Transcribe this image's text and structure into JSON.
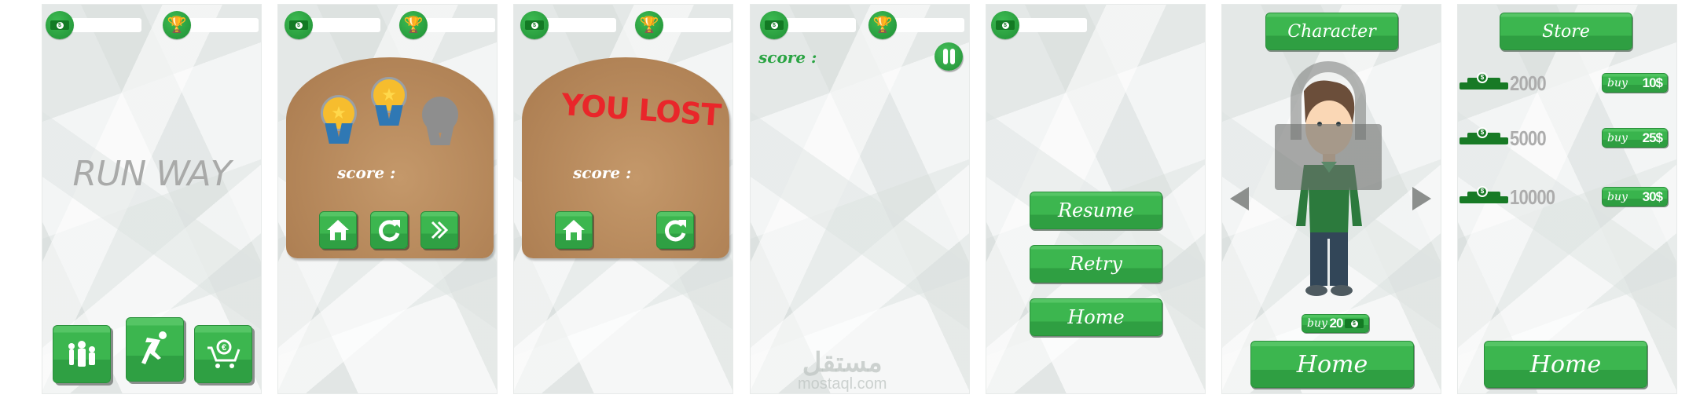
{
  "app": {
    "name": "RUN WAY"
  },
  "colors": {
    "primary_green": "#3cb64f",
    "card_brown": "#b88a5c",
    "lost_red": "#e9262a",
    "muted_gray": "#acacac"
  },
  "hud": {
    "coins_icon": "dollar-bill-icon",
    "best_icon": "trophy-icon",
    "coins_value": "",
    "best_value": ""
  },
  "screens": {
    "home": {
      "title": "RUN WAY",
      "buttons": [
        {
          "label": "Characters",
          "icon": "family-icon"
        },
        {
          "label": "Play",
          "icon": "runner-icon"
        },
        {
          "label": "Store",
          "icon": "cart-euro-icon"
        }
      ]
    },
    "win": {
      "medals": [
        "gold",
        "gold",
        "locked"
      ],
      "score_label": "score :",
      "buttons": [
        {
          "icon": "home-icon"
        },
        {
          "icon": "retry-icon"
        },
        {
          "icon": "next-icon"
        }
      ]
    },
    "lose": {
      "headline": "YOU LOST",
      "score_label": "score :",
      "buttons": [
        {
          "icon": "home-icon"
        },
        {
          "icon": "retry-icon"
        }
      ]
    },
    "gameplay": {
      "score_label": "score :",
      "pause_icon": "pause-icon",
      "watermark_ar": "مستقل",
      "watermark_en": "mostaql.com"
    },
    "pause": {
      "buttons": [
        "Resume",
        "Retry",
        "Home"
      ]
    },
    "character": {
      "title": "Character",
      "buy_label": "buy",
      "price": "20",
      "locked": true,
      "home_label": "Home"
    },
    "store": {
      "title": "Store",
      "items": [
        {
          "coins": "2000",
          "buy_label": "buy",
          "price": "10$"
        },
        {
          "coins": "5000",
          "buy_label": "buy",
          "price": "25$"
        },
        {
          "coins": "10000",
          "buy_label": "buy",
          "price": "30$"
        }
      ],
      "home_label": "Home"
    }
  }
}
